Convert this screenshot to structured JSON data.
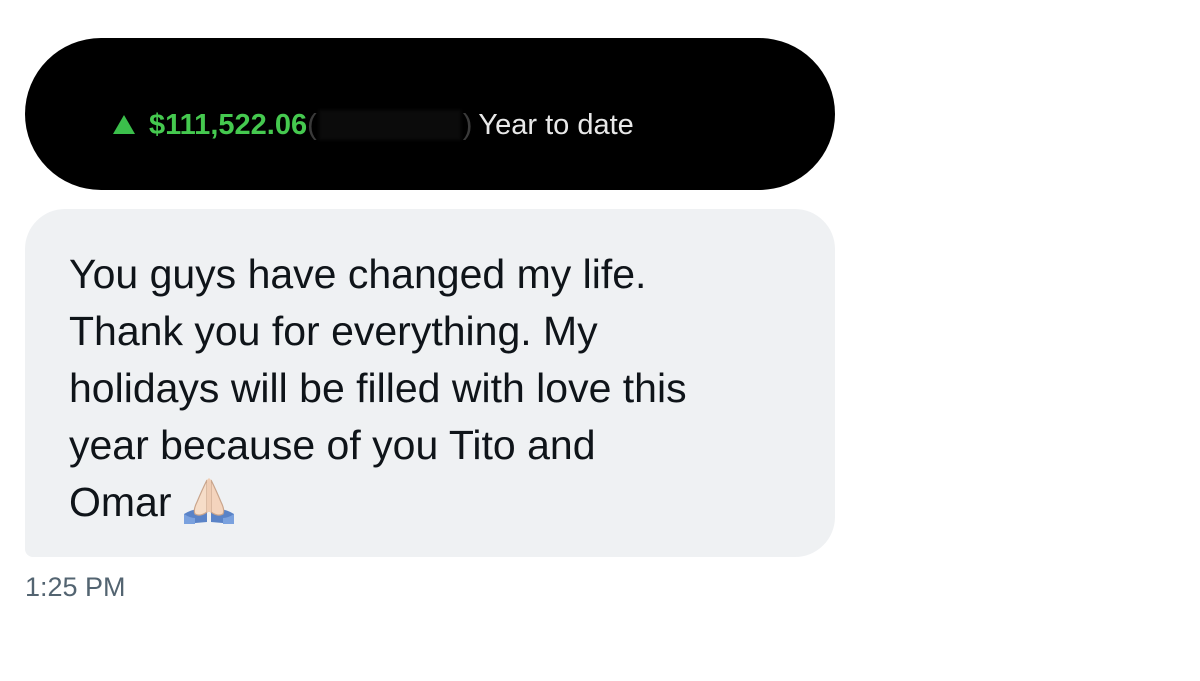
{
  "message_thread": {
    "image_attachment": {
      "change_icon": "up-arrow-icon",
      "change_color": "#45c94f",
      "amount": "$111,522.06",
      "paren_open": "(",
      "paren_close": ")",
      "period": "Year to date"
    },
    "message": {
      "text": "You guys have changed my life.\nThank you for everything. My\nholidays will be filled with love this\nyear because of you Tito and\nOmar",
      "emoji_icon": "folded-hands-icon"
    },
    "timestamp": "1:25 PM"
  }
}
